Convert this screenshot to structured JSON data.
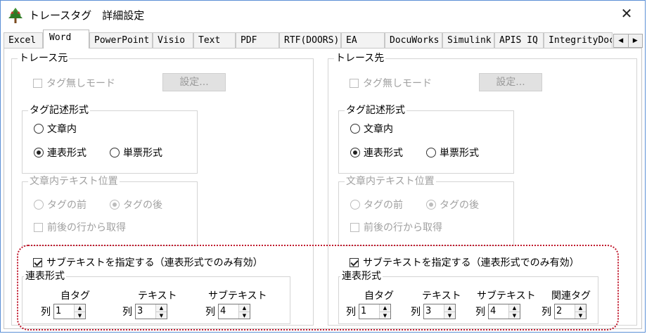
{
  "window": {
    "title": "トレースタグ　詳細設定",
    "close": "✕"
  },
  "tabs": [
    {
      "label": "Excel",
      "active": false
    },
    {
      "label": "Word",
      "active": true
    },
    {
      "label": "PowerPoint",
      "active": false
    },
    {
      "label": "Visio",
      "active": false
    },
    {
      "label": "Text",
      "active": false
    },
    {
      "label": "PDF",
      "active": false
    },
    {
      "label": "RTF(DOORS)",
      "active": false
    },
    {
      "label": "EA",
      "active": false
    },
    {
      "label": "DocuWorks",
      "active": false
    },
    {
      "label": "Simulink",
      "active": false
    },
    {
      "label": "APIS IQ",
      "active": false
    },
    {
      "label": "IntegrityDoc",
      "active": false
    }
  ],
  "tab_scroll": {
    "left": "◀",
    "right": "▶"
  },
  "source": {
    "title": "トレース元",
    "no_tag_mode": "タグ無しモード",
    "settings_button": "設定...",
    "tag_format": {
      "title": "タグ記述形式",
      "in_document": "文章内",
      "sequential": "連表形式",
      "single": "単票形式",
      "selected": "sequential"
    },
    "text_position": {
      "title": "文章内テキスト位置",
      "before_tag": "タグの前",
      "after_tag": "タグの後",
      "selected": "after_tag",
      "from_adjacent": "前後の行から取得"
    },
    "subtext": {
      "checkbox": "サブテキストを指定する（連表形式でのみ有効）",
      "checked": true,
      "group_title": "連表形式",
      "col_label": "列",
      "columns": [
        {
          "header": "自タグ",
          "value": "1"
        },
        {
          "header": "テキスト",
          "value": "3"
        },
        {
          "header": "サブテキスト",
          "value": "4"
        }
      ]
    }
  },
  "target": {
    "title": "トレース先",
    "no_tag_mode": "タグ無しモード",
    "settings_button": "設定...",
    "tag_format": {
      "title": "タグ記述形式",
      "in_document": "文章内",
      "sequential": "連表形式",
      "single": "単票形式",
      "selected": "sequential"
    },
    "text_position": {
      "title": "文章内テキスト位置",
      "before_tag": "タグの前",
      "after_tag": "タグの後",
      "selected": "after_tag",
      "from_adjacent": "前後の行から取得"
    },
    "subtext": {
      "checkbox": "サブテキストを指定する（連表形式でのみ有効）",
      "checked": true,
      "group_title": "連表形式",
      "col_label": "列",
      "columns": [
        {
          "header": "自タグ",
          "value": "1"
        },
        {
          "header": "テキスト",
          "value": "3"
        },
        {
          "header": "サブテキスト",
          "value": "4"
        },
        {
          "header": "関連タグ",
          "value": "2"
        }
      ]
    }
  },
  "colors": {
    "window_border": "#5b8fd6",
    "highlight": "#c0182c",
    "disabled_text": "#a0a0a0"
  }
}
